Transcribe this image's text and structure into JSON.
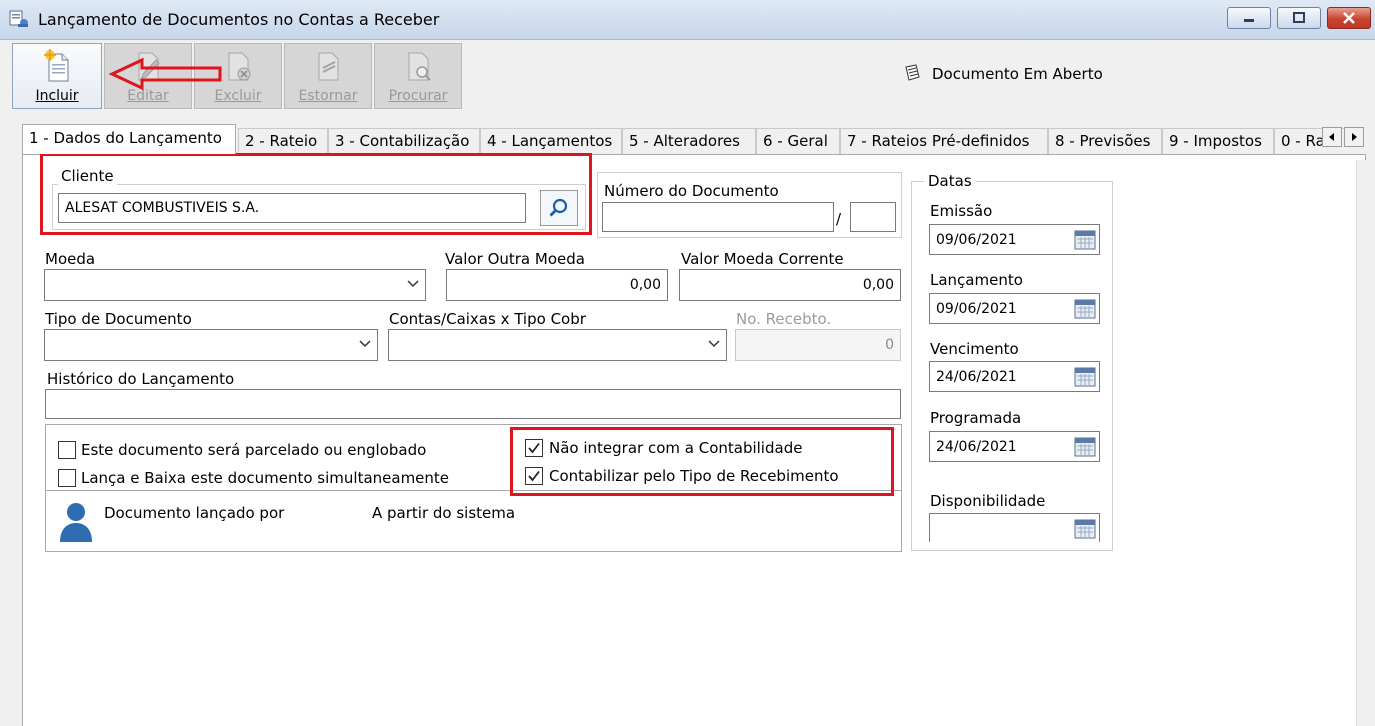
{
  "window": {
    "title": "Lançamento de Documentos no Contas a Receber"
  },
  "toolbar": {
    "incluir": "Incluir",
    "editar": "Editar",
    "excluir": "Excluir",
    "estornar": "Estornar",
    "procurar": "Procurar",
    "status": "Documento Em Aberto"
  },
  "tabs": [
    {
      "label": "1 - Dados do Lançamento",
      "active": true
    },
    {
      "label": "2 - Rateio"
    },
    {
      "label": "3 - Contabilização"
    },
    {
      "label": "4 - Lançamentos"
    },
    {
      "label": "5 - Alteradores"
    },
    {
      "label": "6 - Geral"
    },
    {
      "label": "7 - Rateios Pré-definidos"
    },
    {
      "label": "8 - Previsões"
    },
    {
      "label": "9 - Impostos"
    },
    {
      "label": "0 - Ra"
    }
  ],
  "form": {
    "cliente": {
      "label": "Cliente",
      "value": "ALESAT COMBUSTIVEIS S.A."
    },
    "numero_documento": {
      "label": "Número do Documento",
      "separator": "/"
    },
    "moeda": {
      "label": "Moeda",
      "value": ""
    },
    "valor_outra_moeda": {
      "label": "Valor Outra Moeda",
      "value": "0,00"
    },
    "valor_moeda_corrente": {
      "label": "Valor Moeda Corrente",
      "value": "0,00"
    },
    "tipo_documento": {
      "label": "Tipo de Documento",
      "value": ""
    },
    "contas_caixas": {
      "label": "Contas/Caixas x Tipo Cobr",
      "value": ""
    },
    "no_recebto": {
      "label": "No. Recebto.",
      "value": "0"
    },
    "historico": {
      "label": "Histórico do Lançamento",
      "value": ""
    },
    "checkboxes": {
      "parcelado": {
        "label": "Este documento será parcelado ou englobado",
        "checked": false
      },
      "lanca_baixa": {
        "label": "Lança e Baixa este documento simultaneamente",
        "checked": false
      },
      "nao_integrar": {
        "label": "Não integrar com a Contabilidade",
        "checked": true
      },
      "contabilizar": {
        "label": "Contabilizar pelo Tipo de Recebimento",
        "checked": true
      }
    },
    "lancado_por": {
      "label": "Documento lançado por",
      "value": "A partir do sistema"
    }
  },
  "datas": {
    "title": "Datas",
    "emissao": {
      "label": "Emissão",
      "value": "09/06/2021"
    },
    "lancamento": {
      "label": "Lançamento",
      "value": "09/06/2021"
    },
    "vencimento": {
      "label": "Vencimento",
      "value": "24/06/2021"
    },
    "programada": {
      "label": "Programada",
      "value": "24/06/2021"
    },
    "disponibilidade": {
      "label": "Disponibilidade",
      "value": ""
    }
  },
  "colors": {
    "highlight": "#e0141e",
    "window_accent": "#c6d6ea"
  }
}
